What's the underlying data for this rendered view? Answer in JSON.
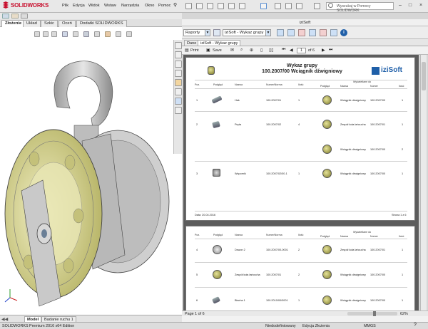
{
  "app": {
    "logo_text": "SOLIDWORKS",
    "menus": [
      "Plik",
      "Edycja",
      "Widok",
      "Wstaw",
      "Narzędzia",
      "Okno",
      "Pomoc"
    ],
    "search_placeholder": "Wyszukaj w Pomocy SOLIDWORK",
    "window_buttons": [
      "–",
      "□",
      "×"
    ]
  },
  "command_tabs": [
    "Złożenie",
    "Układ",
    "Szkic",
    "Oceń",
    "Dodatki SOLIDWORKS"
  ],
  "model_tabs": [
    "Model",
    "Badanie ruchu 1"
  ],
  "status": {
    "edition": "SOLIDWORKS Premium 2016 x64 Edition",
    "state": "Niedodefiniowany",
    "mode": "Edycja Złożenia",
    "units": "MMGS"
  },
  "izisoft": {
    "panel_title": "iziSoft",
    "report_select": "Raporty",
    "report_name": "iziSoft - Wykaz grupy",
    "tabs": [
      "Dane",
      "iziSoft - Wykaz grupy"
    ],
    "print_label": "Print",
    "save_label": "Save",
    "page_current": "1",
    "page_total": "of 6",
    "footer_page": "Page 1 of 6",
    "zoom": "62%"
  },
  "report": {
    "title": "Wykaz grupy",
    "subtitle": "100.2007/00 Wciągnik dźwigniowy",
    "brand": "iziSoft",
    "columns": [
      "Poz.",
      "Podgląd",
      "Nazwa",
      "Numer/Norma",
      "Ilość"
    ],
    "sub_header": "Wyświetlane do",
    "sub_columns": [
      "Podgląd",
      "Nazwa",
      "Numer",
      "Ilość"
    ],
    "page1_rows": [
      {
        "poz": "1",
        "nazwa": "Hak",
        "numer": "100.2007/01",
        "ilosc": "1",
        "sub_nazwa": "Wciągnik dźwigniowy",
        "sub_numer": "100.2007/00",
        "sub_ilosc": "1"
      },
      {
        "poz": "2",
        "nazwa": "Pręta",
        "numer": "100.2007/02",
        "ilosc": "4",
        "sub_nazwa": "Zespół koła łańcucha",
        "sub_numer": "100.2007/01",
        "sub_ilosc": "1"
      },
      {
        "poz": "",
        "nazwa": "",
        "numer": "",
        "ilosc": "",
        "sub_nazwa": "Wciągnik dźwigniowy",
        "sub_numer": "100.2007/00",
        "sub_ilosc": "2"
      },
      {
        "poz": "3",
        "nazwa": "Wspornik",
        "numer": "100.2007/02/00-1",
        "ilosc": "1",
        "sub_nazwa": "Wciągnik dźwigniowy",
        "sub_numer": "100.2007/00",
        "sub_ilosc": "1"
      }
    ],
    "page1_date": "Data: 20.04.2016",
    "page1_pagenum": "Strona 1 z 6",
    "page2_rows": [
      {
        "poz": "4",
        "nazwa": "Dzwon 2",
        "numer": "100.2007/00-0001",
        "ilosc": "2",
        "sub_nazwa": "Zespół koła łańcucha",
        "sub_numer": "100.2007/01",
        "sub_ilosc": "1"
      },
      {
        "poz": "5",
        "nazwa": "Zespół koła łańcucha",
        "numer": "100.2007/01",
        "ilosc": "2",
        "sub_nazwa": "Wciągnik dźwigniowy",
        "sub_numer": "100.2007/00",
        "sub_ilosc": "1"
      },
      {
        "poz": "6",
        "nazwa": "Blacha 1",
        "numer": "100.2010/00/0001",
        "ilosc": "1",
        "sub_nazwa": "Wciągnik dźwigniowy",
        "sub_numer": "100.2007/00",
        "sub_ilosc": "1"
      }
    ]
  },
  "colors": {
    "brand_red": "#c8102e",
    "model_yellow": "#e4e29a",
    "izisoft_blue": "#1f5fa8"
  }
}
